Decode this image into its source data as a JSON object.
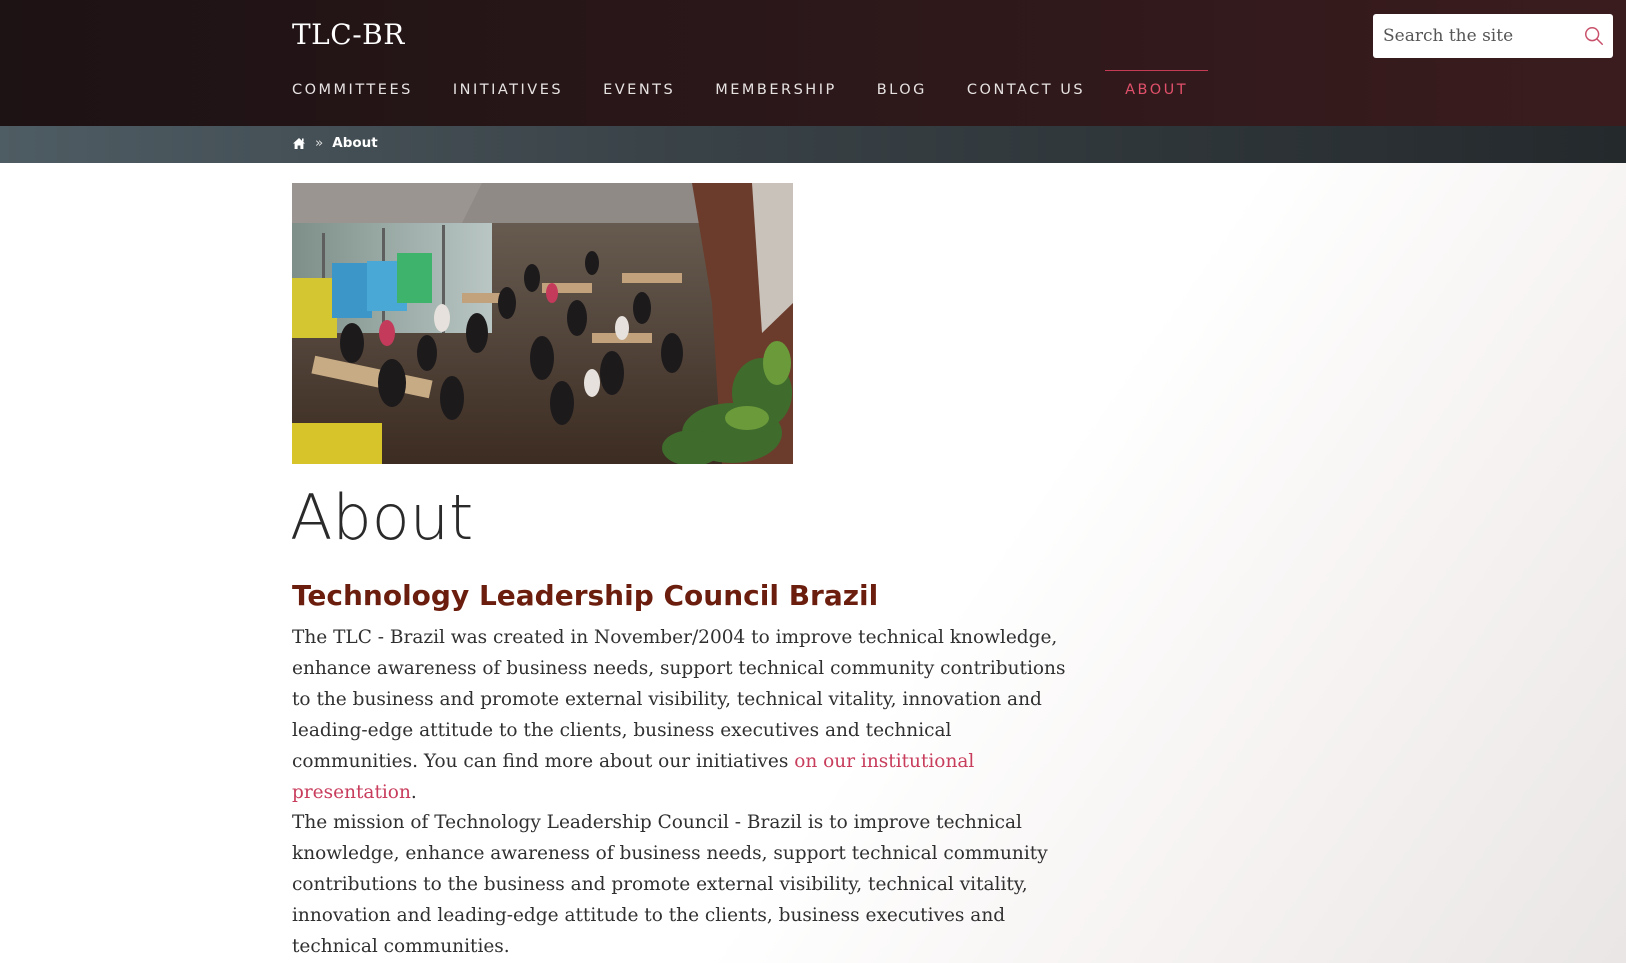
{
  "site": {
    "title": "TLC-BR"
  },
  "search": {
    "placeholder": "Search the site",
    "value": "",
    "icon": "search-icon"
  },
  "nav": {
    "items": [
      {
        "label": "COMMITTEES",
        "active": false
      },
      {
        "label": "INITIATIVES",
        "active": false
      },
      {
        "label": "EVENTS",
        "active": false
      },
      {
        "label": "MEMBERSHIP",
        "active": false
      },
      {
        "label": "BLOG",
        "active": false
      },
      {
        "label": "CONTACT US",
        "active": false
      },
      {
        "label": "ABOUT",
        "active": true
      }
    ]
  },
  "breadcrumb": {
    "home_icon": "home-icon",
    "separator": "»",
    "current": "About"
  },
  "main": {
    "image": "event photo",
    "title": "About",
    "heading": "Technology Leadership Council Brazil",
    "paragraph1_text": "The TLC - Brazil was created in November/2004 to improve technical knowledge, enhance awareness of business needs, support technical community contributions to the business and promote external visibility, technical vitality, innovation and leading-edge attitude to the clients, business executives and technical communities. You can find more about our initiatives ",
    "paragraph1_link": "on our institutional presentation",
    "paragraph1_end": ".",
    "paragraph2": "The mission of Technology Leadership Council - Brazil is to improve technical knowledge, enhance awareness of business needs, support technical community contributions to the business and promote external visibility, technical vitality, innovation and leading-edge attitude to the clients, business executives and technical communities."
  },
  "colors": {
    "header_bg": "#2a1719",
    "accent": "#c83c5c",
    "heading": "#6b1e0e",
    "breadcrumb_bg": "#3a4348"
  }
}
